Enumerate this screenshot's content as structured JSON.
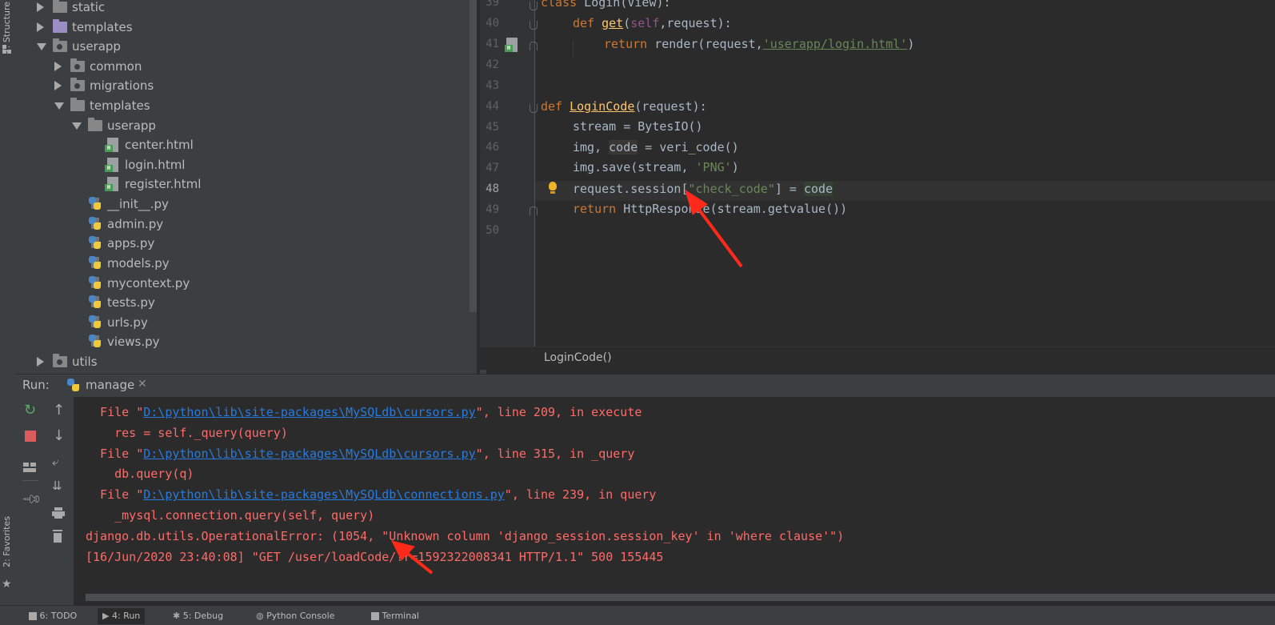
{
  "left_strip": {
    "structure_label": "7: Structure",
    "favorites_label": "2: Favorites"
  },
  "project_tree": [
    {
      "label": "static",
      "type": "folder"
    },
    {
      "label": "templates",
      "type": "folder-purple"
    },
    {
      "label": "userapp",
      "type": "package"
    },
    {
      "label": "common",
      "type": "package"
    },
    {
      "label": "migrations",
      "type": "package"
    },
    {
      "label": "templates",
      "type": "folder"
    },
    {
      "label": "userapp",
      "type": "folder"
    },
    {
      "label": "center.html",
      "type": "html"
    },
    {
      "label": "login.html",
      "type": "html"
    },
    {
      "label": "register.html",
      "type": "html"
    },
    {
      "label": "__init__.py",
      "type": "py"
    },
    {
      "label": "admin.py",
      "type": "py"
    },
    {
      "label": "apps.py",
      "type": "py"
    },
    {
      "label": "models.py",
      "type": "py"
    },
    {
      "label": "mycontext.py",
      "type": "py"
    },
    {
      "label": "tests.py",
      "type": "py"
    },
    {
      "label": "urls.py",
      "type": "py"
    },
    {
      "label": "views.py",
      "type": "py"
    },
    {
      "label": "utils",
      "type": "package"
    }
  ],
  "editor": {
    "line_numbers": [
      "39",
      "40",
      "41",
      "42",
      "43",
      "44",
      "45",
      "46",
      "47",
      "48",
      "49",
      "50"
    ],
    "current_line": "48",
    "code": {
      "l39_kw": "class",
      "l39_rest": " Login(View):",
      "l40_kw": "def",
      "l40_fn": "get",
      "l40_p1": "(",
      "l40_self": "self",
      "l40_p2": ",request):",
      "l41_kw": "return",
      "l41_p1": " render(request,",
      "l41_str": "'userapp/login.html'",
      "l41_p2": ")",
      "l44_kw": "def",
      "l44_fn": "LoginCode",
      "l44_rest": "(request):",
      "l45": "stream = BytesIO()",
      "l46_p1": "img, ",
      "l46_code": "code",
      "l46_p2": " = veri_code()",
      "l47_p1": "img.save(stream, ",
      "l47_str": "'PNG'",
      "l47_p2": ")",
      "l48_p1": "request.session[",
      "l48_str": "\"check_code\"",
      "l48_p2": "] = ",
      "l48_code": "code",
      "l49_kw": "return",
      "l49_rest": " HttpResponse(stream.getvalue())"
    },
    "breadcrumb": "LoginCode()"
  },
  "run_panel": {
    "label": "Run:",
    "tab": "manage",
    "console": {
      "l1_pre": "  File \"",
      "l1_link": "D:\\python\\lib\\site-packages\\MySQLdb\\cursors.py",
      "l1_post": "\", line 209, in execute",
      "l2": "    res = self._query(query)",
      "l3_pre": "  File \"",
      "l3_link": "D:\\python\\lib\\site-packages\\MySQLdb\\cursors.py",
      "l3_post": "\", line 315, in _query",
      "l4": "    db.query(q)",
      "l5_pre": "  File \"",
      "l5_link": "D:\\python\\lib\\site-packages\\MySQLdb\\connections.py",
      "l5_post": "\", line 239, in query",
      "l6": "    _mysql.connection.query(self, query)",
      "l7": "django.db.utils.OperationalError: (1054, \"Unknown column 'django_session.session_key' in 'where clause'\")",
      "l8": "[16/Jun/2020 23:40:08] \"GET /user/loadCode/?r=1592322008341 HTTP/1.1\" 500 155445"
    }
  },
  "bottom_tools": [
    "6: TODO",
    "4: Run",
    "5: Debug",
    "Python Console",
    "Terminal"
  ],
  "colors": {
    "annotation_arrow": "#ff2a1a",
    "error_text": "#ff6b68",
    "link": "#287bde"
  }
}
